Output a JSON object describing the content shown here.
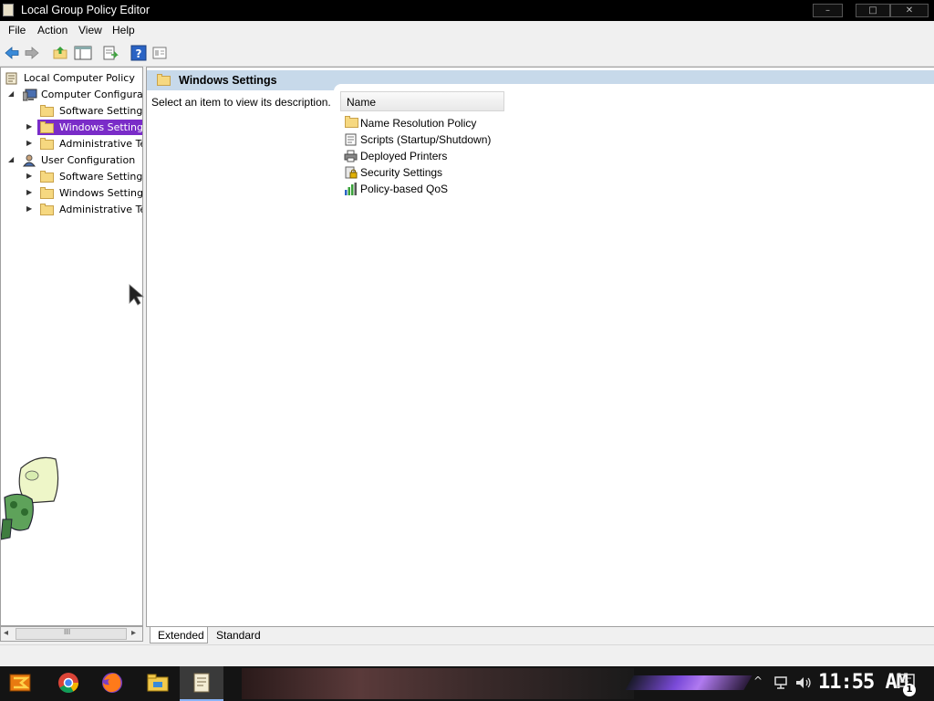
{
  "window": {
    "title": "Local Group Policy Editor",
    "minimize": "–",
    "maximize": "□",
    "close": "✕"
  },
  "menu": [
    "File",
    "Action",
    "View",
    "Help"
  ],
  "toolbar": {
    "icons": [
      "back-icon",
      "forward-icon",
      "up-folder-icon",
      "show-hide-tree-icon",
      "export-list-icon",
      "help-icon",
      "properties-icon"
    ]
  },
  "tree": {
    "root": "Local Computer Policy",
    "computer_config": "Computer Configurati",
    "cc_software": "Software Setting",
    "cc_windows": "Windows Setting",
    "cc_admin": "Administrative Te",
    "user_config": "User Configuration",
    "uc_software": "Software Setting",
    "uc_windows": "Windows Setting:",
    "uc_admin": "Administrative Te"
  },
  "scroll": {
    "left": "◂",
    "right": "▸",
    "grip": "III"
  },
  "pane": {
    "header": "Windows Settings",
    "description": "Select an item to view its description.",
    "column_name": "Name"
  },
  "items": [
    {
      "label": "Name Resolution Policy",
      "icon": "folder-icon"
    },
    {
      "label": "Scripts (Startup/Shutdown)",
      "icon": "script-icon"
    },
    {
      "label": "Deployed Printers",
      "icon": "printer-icon"
    },
    {
      "label": "Security Settings",
      "icon": "security-icon"
    },
    {
      "label": "Policy-based QoS",
      "icon": "qos-chart-icon"
    }
  ],
  "tabs": [
    "Extended",
    "Standard"
  ],
  "taskbar": {
    "clock": "11:55 AM",
    "notification_count": "1",
    "apps": [
      "start-icon",
      "chrome-icon",
      "firefox-icon",
      "file-explorer-icon",
      "group-policy-icon"
    ]
  },
  "colors": {
    "selection": "#7a2cc8",
    "header_band": "#c7d9ea",
    "taskbar": "#141414"
  }
}
